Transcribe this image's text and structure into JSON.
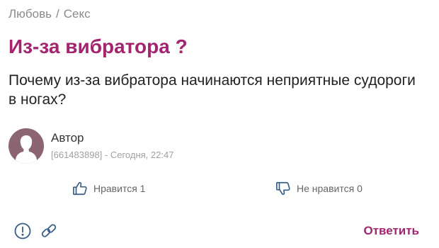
{
  "breadcrumb": {
    "category": "Любовь",
    "separator": "/",
    "subcategory": "Секс"
  },
  "post": {
    "title": "Из-за вибратора ?",
    "body": "Почему из-за вибратора начинаются неприятные судороги в ногах?"
  },
  "author": {
    "name": "Автор",
    "meta": "[661483898] - Сегодня, 22:47",
    "avatar_icon": "user-silhouette-icon"
  },
  "votes": {
    "like_label": "Нравится 1",
    "dislike_label": "Не нравится 0"
  },
  "actions": {
    "reply_label": "Ответить",
    "report_icon": "exclamation-circle-icon",
    "link_icon": "link-icon"
  },
  "colors": {
    "accent": "#a3246f",
    "avatar_bg": "#8b6571",
    "muted_text": "#8a8a8a"
  }
}
